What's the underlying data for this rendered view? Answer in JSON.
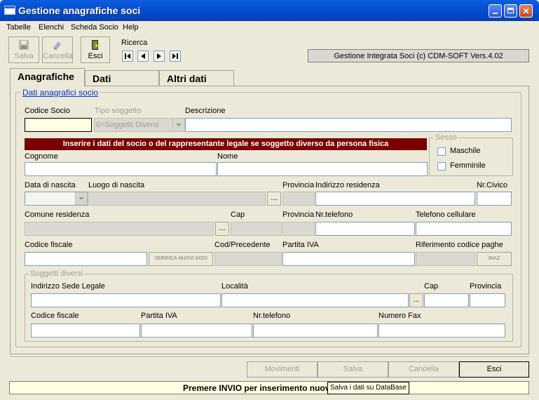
{
  "window": {
    "title": "Gestione anagrafiche soci"
  },
  "menu": [
    "Tabelle",
    "Elenchi",
    "Scheda Socio",
    "Help"
  ],
  "toolbar": {
    "salva": "Salva",
    "cancella": "Cancella",
    "esci": "Esci",
    "ricerca": "Ricerca"
  },
  "info": "Gestione Integrata Soci (c) CDM-SOFT Vers.4.02",
  "tabs": [
    "Anagrafiche",
    "Dati contabili",
    "Altri dati"
  ],
  "section_title": "Dati anagrafici socio",
  "fields": {
    "codice_socio": "Codice Socio",
    "tipo_soggetto": "Tipo soggetto",
    "tipo_soggetto_value": "0=Soggetti Diversi",
    "descrizione": "Descrizione",
    "banner": "Inserire i dati del socio o del rappresentante legale se soggetto diverso da persona fisica",
    "cognome": "Cognome",
    "nome": "Nome",
    "sesso": "Sesso",
    "maschile": "Maschile",
    "femminile": "Femminile",
    "data_nascita": "Data di nascita",
    "luogo_nascita": "Luogo di nascita",
    "provincia": "Provincia",
    "indirizzo_residenza": "Indirizzo residenza",
    "nr_civico": "Nr.Civico",
    "comune_residenza": "Comune residenza",
    "cap": "Cap",
    "nr_telefono": "Nr.telefono",
    "telefono_cellulare": "Telefono cellulare",
    "codice_fiscale": "Codice fiscale",
    "cod_precedente": "Cod/Precedente",
    "partita_iva": "Partita IVA",
    "riferimento_paghe": "Riferimento codice paghe",
    "verifica_btn": "VERIFICA NUOVI SOCI",
    "inaz_btn": "INAZ",
    "dots": "..."
  },
  "soggetti": {
    "title": "Soggetti diversi",
    "indirizzo_sede": "Indirizzo Sede Legale",
    "localita": "Località",
    "cap": "Cap",
    "provincia": "Provincia",
    "codice_fiscale": "Codice fiscale",
    "partita_iva": "Partita IVA",
    "nr_telefono": "Nr.telefono",
    "numero_fax": "Numero Fax"
  },
  "bottom_buttons": [
    "Movimenti",
    "Salva",
    "Cancella",
    "Esci"
  ],
  "status": "Premere INVIO per inserimento nuov",
  "tooltip": "Salva i dati su DataBase"
}
